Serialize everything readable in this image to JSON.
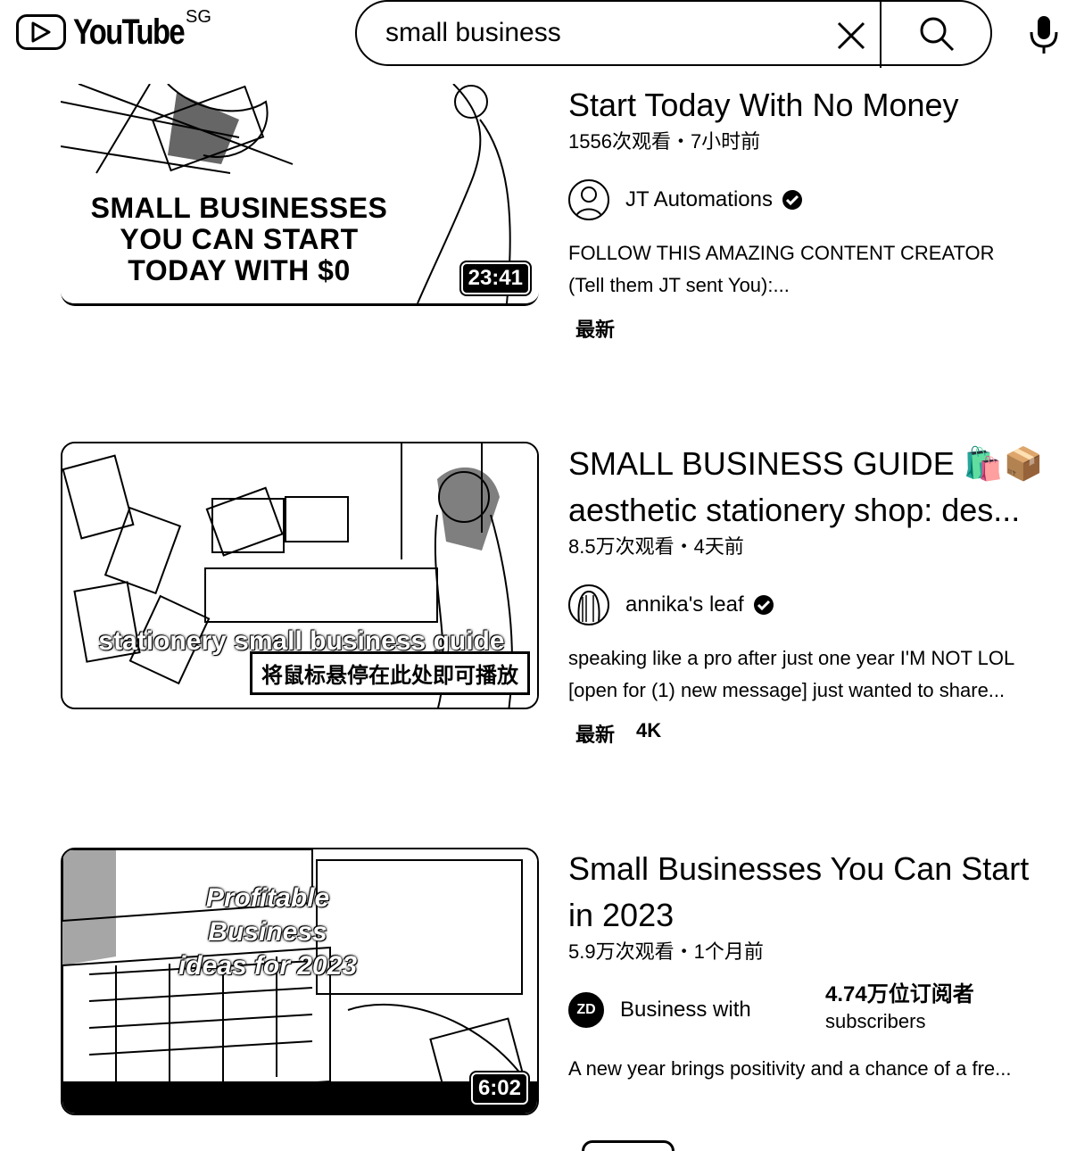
{
  "header": {
    "logo_text": "YouTube",
    "region": "SG",
    "search_value": "small business"
  },
  "videos": [
    {
      "thumb_caption": [
        "SMALL BUSINESSES",
        "YOU CAN START",
        "TODAY WITH $0"
      ],
      "duration": "23:41",
      "title": "Start Today With No Money",
      "meta": "1556次观看・7小时前",
      "channel": "JT Automations",
      "verified": true,
      "description": [
        "FOLLOW THIS AMAZING CONTENT CREATOR",
        "(Tell them JT sent You):..."
      ],
      "badges": [
        "最新"
      ]
    },
    {
      "thumb_caption": [
        "stationery small business guide"
      ],
      "hover_hint": "将鼠标悬停在此处即可播放",
      "title_line1": "SMALL BUSINESS GUIDE 🛍️📦",
      "title_line2": "aesthetic stationery shop: des...",
      "meta": "8.5万次观看・4天前",
      "channel": "annika's leaf",
      "verified": true,
      "description": [
        "speaking like a pro after just one year I'M NOT LOL",
        "[open for (1) new message] just wanted to share..."
      ],
      "badges": [
        "最新",
        "4K"
      ]
    },
    {
      "thumb_caption": [
        "Profitable Business",
        "ideas for 2023"
      ],
      "duration": "6:02",
      "title_line1": "Small Businesses You Can Start",
      "title_line2": "in 2023",
      "meta": "5.9万次观看・1个月前",
      "channel": "Business with",
      "avatar_text": "ZD",
      "subs_count": "4.74万位订阅者",
      "subs_label": "subscribers",
      "description": [
        "A new year brings positivity and a chance of a fre..."
      ]
    }
  ]
}
